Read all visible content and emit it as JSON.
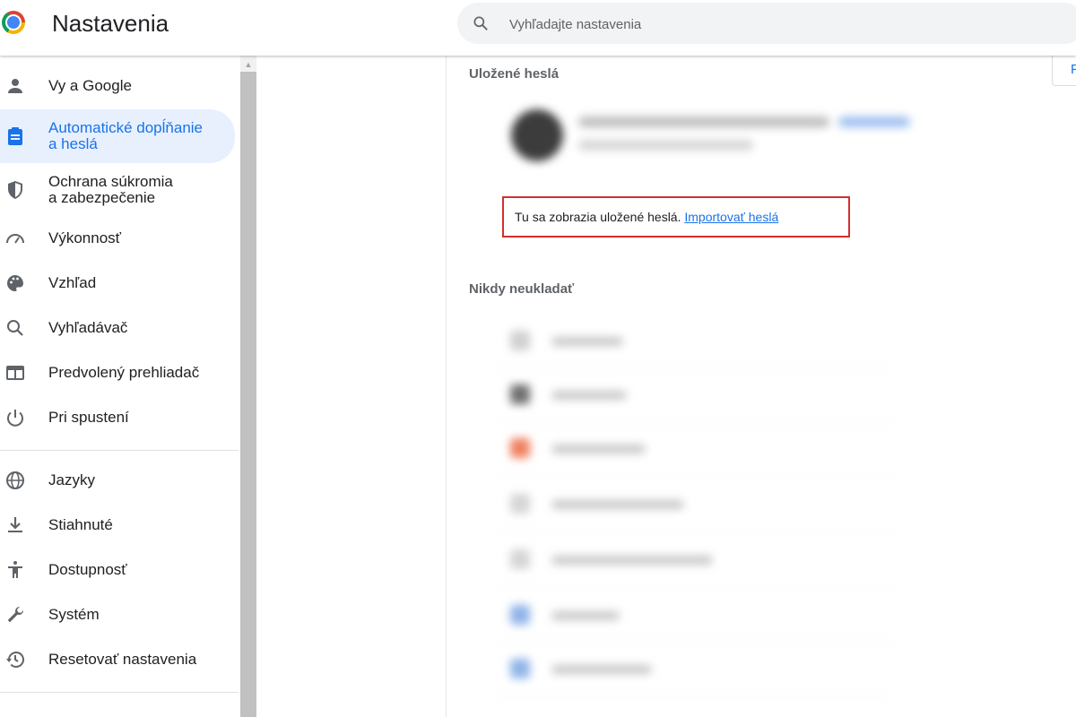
{
  "header": {
    "title": "Nastavenia",
    "search_placeholder": "Vyhľadajte nastavenia"
  },
  "sidebar": {
    "items": [
      {
        "label": "Vy a Google",
        "icon": "person-icon"
      },
      {
        "label": "Automatické dopĺňanie\na heslá",
        "icon": "clipboard-icon",
        "active": true
      },
      {
        "label": "Ochrana súkromia\na zabezpečenie",
        "icon": "shield-icon"
      },
      {
        "label": "Výkonnosť",
        "icon": "speedometer-icon"
      },
      {
        "label": "Vzhľad",
        "icon": "palette-icon"
      },
      {
        "label": "Vyhľadávač",
        "icon": "search-icon"
      },
      {
        "label": "Predvolený prehliadač",
        "icon": "browser-icon"
      },
      {
        "label": "Pri spustení",
        "icon": "power-icon"
      },
      {
        "label": "Jazyky",
        "icon": "globe-icon"
      },
      {
        "label": "Stiahnuté",
        "icon": "download-icon"
      },
      {
        "label": "Dostupnosť",
        "icon": "accessibility-icon"
      },
      {
        "label": "Systém",
        "icon": "wrench-icon"
      },
      {
        "label": "Resetovať nastavenia",
        "icon": "reset-history-icon"
      }
    ]
  },
  "main": {
    "saved_passwords_title": "Uložené heslá",
    "empty_text": "Tu sa zobrazia uložené heslá.",
    "import_link": "Importovať heslá",
    "never_save_title": "Nikdy neukladať",
    "corner_button_label": "P"
  },
  "colors": {
    "accent": "#1a73e8",
    "active_bg": "#e8f0fe",
    "highlight_border": "#d32f2f"
  }
}
